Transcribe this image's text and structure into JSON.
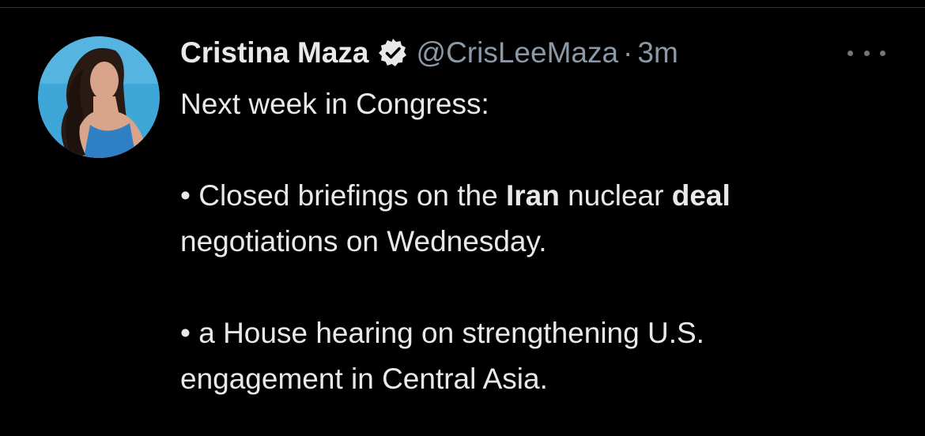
{
  "tweet": {
    "display_name": "Cristina Maza",
    "handle": "@CrisLeeMaza",
    "separator": "·",
    "time": "3m",
    "lines": {
      "intro": "Next week in Congress:",
      "bullet1_prefix": "• Closed briefings on the ",
      "bullet1_bold1": "Iran",
      "bullet1_mid": " nuclear ",
      "bullet1_bold2": "deal",
      "bullet1_line2": "negotiations on Wednesday.",
      "bullet2_line1": "• a House hearing on strengthening U.S.",
      "bullet2_line2": "engagement in Central Asia."
    }
  },
  "icons": {
    "verified": "verified-badge-icon",
    "more": "more-options-icon"
  },
  "colors": {
    "background": "#000000",
    "text": "#e7e9ea",
    "muted": "#8b98a5",
    "avatar_bg": "#3fa6d8"
  }
}
